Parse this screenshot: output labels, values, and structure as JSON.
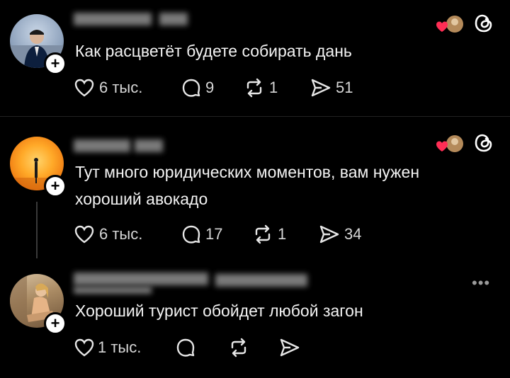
{
  "posts": [
    {
      "text": "Как расцветёт будете собирать дань",
      "likes": "6 тыс.",
      "replies": "9",
      "reposts": "1",
      "shares": "51"
    },
    {
      "text_line1": "Тут много юридических моментов, вам нужен",
      "text_line2": "хороший авокадо",
      "likes": "6 тыс.",
      "replies": "17",
      "reposts": "1",
      "shares": "34"
    },
    {
      "text": "Хороший турист обойдет любой загон",
      "likes": "1 тыс.",
      "more": "•••"
    }
  ],
  "icons": [
    "heart-icon",
    "reply-icon",
    "repost-icon",
    "share-icon",
    "threads-logo-icon",
    "follow-plus-icon",
    "more-icon"
  ],
  "colors": {
    "background": "#000000",
    "text": "#f2f2f2",
    "secondary": "#d6d6d6",
    "like_badge": "#ff2e55"
  }
}
